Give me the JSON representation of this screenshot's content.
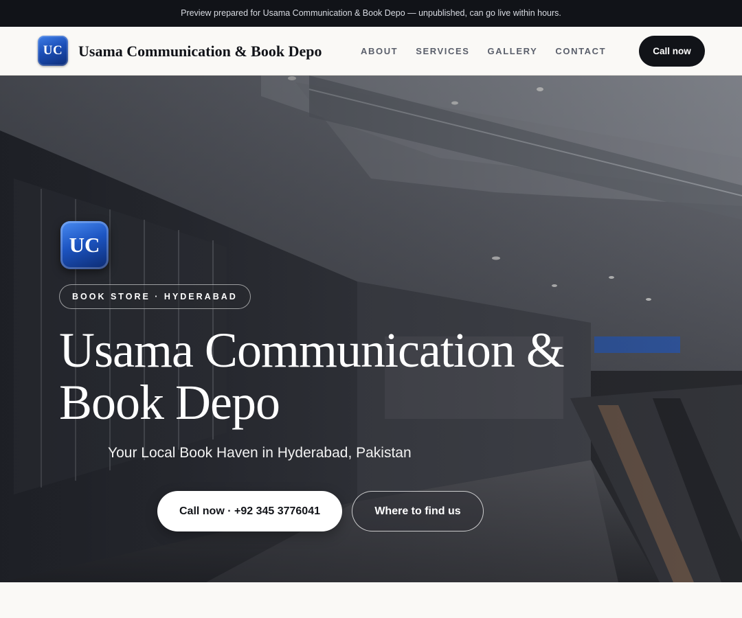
{
  "banner": {
    "text": "Preview prepared for Usama Communication & Book Depo — unpublished, can go live within hours."
  },
  "header": {
    "logo_text": "UC",
    "brand_name": "Usama Communication & Book Depo",
    "nav": [
      {
        "label": "ABOUT"
      },
      {
        "label": "SERVICES"
      },
      {
        "label": "GALLERY"
      },
      {
        "label": "CONTACT"
      }
    ],
    "cta_label": "Call now"
  },
  "hero": {
    "logo_text": "UC",
    "tag": "BOOK STORE · HYDERABAD",
    "title": "Usama Communication & Book Depo",
    "subtitle": "Your Local Book Haven in Hyderabad, Pakistan",
    "primary_cta": "Call now · +92 345 3776041",
    "secondary_cta": "Where to find us"
  },
  "colors": {
    "dark": "#111318",
    "page_bg": "#faf9f6",
    "brand_blue": "#1b4fb8",
    "nav_text": "#5a5f6b"
  },
  "icons": [
    "logo-badge",
    "hero-photo"
  ]
}
